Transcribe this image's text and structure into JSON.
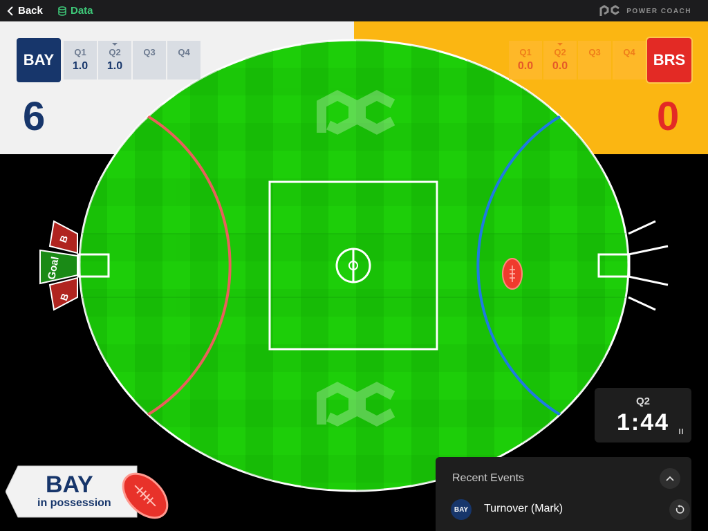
{
  "topbar": {
    "back_label": "Back",
    "data_label": "Data",
    "brand_name": "POWER COACH"
  },
  "home": {
    "abbr": "BAY",
    "color": "#17366b",
    "score": "6",
    "quarters": [
      {
        "label": "Q1",
        "score": "1.0"
      },
      {
        "label": "Q2",
        "score": "1.0",
        "current": true
      },
      {
        "label": "Q3",
        "score": ""
      },
      {
        "label": "Q4",
        "score": ""
      }
    ]
  },
  "away": {
    "abbr": "BRS",
    "color": "#e32a25",
    "score": "0",
    "quarters": [
      {
        "label": "Q1",
        "score": "0.0"
      },
      {
        "label": "Q2",
        "score": "0.0",
        "current": true
      },
      {
        "label": "Q3",
        "score": ""
      },
      {
        "label": "Q4",
        "score": ""
      }
    ]
  },
  "field": {
    "goal_label": "Goal",
    "behind_label": "B",
    "home_arc_color": "#e8605b",
    "away_arc_color": "#1e7be0",
    "grass_color": "#1dce09"
  },
  "clock": {
    "quarter": "Q2",
    "time": "1:44"
  },
  "possession": {
    "team": "BAY",
    "label": "in possession"
  },
  "events": {
    "title": "Recent Events",
    "items": [
      {
        "team": "BAY",
        "text": "Turnover (Mark)"
      }
    ]
  }
}
